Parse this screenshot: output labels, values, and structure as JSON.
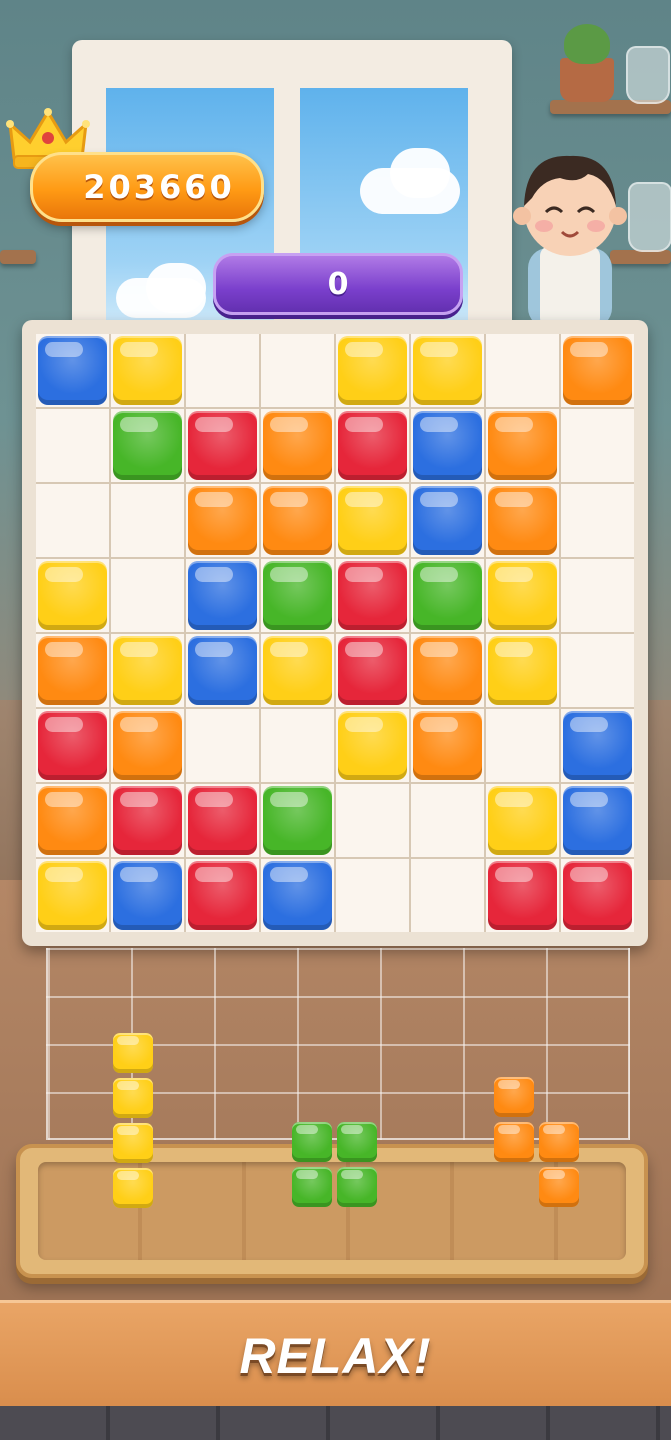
{
  "hud": {
    "best_score": "203660",
    "current_score": "0"
  },
  "colors": {
    "blue": "#2c6fe0",
    "yellow": "#ffcf17",
    "orange": "#ff8a12",
    "red": "#e6263a",
    "green": "#47b628"
  },
  "board": {
    "rows": [
      [
        "blue",
        "yellow",
        "",
        "",
        "yellow",
        "yellow",
        "",
        "orange"
      ],
      [
        "",
        "green",
        "red",
        "orange",
        "red",
        "blue",
        "orange",
        ""
      ],
      [
        "",
        "",
        "orange",
        "orange",
        "yellow",
        "blue",
        "orange",
        ""
      ],
      [
        "yellow",
        "",
        "blue",
        "green",
        "red",
        "green",
        "yellow",
        ""
      ],
      [
        "orange",
        "yellow",
        "blue",
        "yellow",
        "red",
        "orange",
        "yellow",
        ""
      ],
      [
        "red",
        "orange",
        "",
        "",
        "yellow",
        "orange",
        "",
        "blue"
      ],
      [
        "orange",
        "red",
        "red",
        "green",
        "",
        "",
        "yellow",
        "blue"
      ],
      [
        "yellow",
        "blue",
        "red",
        "blue",
        "",
        "",
        "red",
        "red"
      ]
    ]
  },
  "pieces": [
    {
      "name": "yellow-i-piece",
      "color": "yellow",
      "cells": [
        [
          0,
          0
        ],
        [
          0,
          1
        ],
        [
          0,
          2
        ],
        [
          0,
          3
        ]
      ]
    },
    {
      "name": "green-square-piece",
      "color": "green",
      "cells": [
        [
          0,
          0
        ],
        [
          1,
          0
        ],
        [
          0,
          1
        ],
        [
          1,
          1
        ]
      ]
    },
    {
      "name": "orange-s-piece",
      "color": "orange",
      "cells": [
        [
          0,
          0
        ],
        [
          0,
          1
        ],
        [
          1,
          1
        ],
        [
          1,
          2
        ]
      ]
    }
  ],
  "banner": {
    "text": "RELAX!"
  }
}
